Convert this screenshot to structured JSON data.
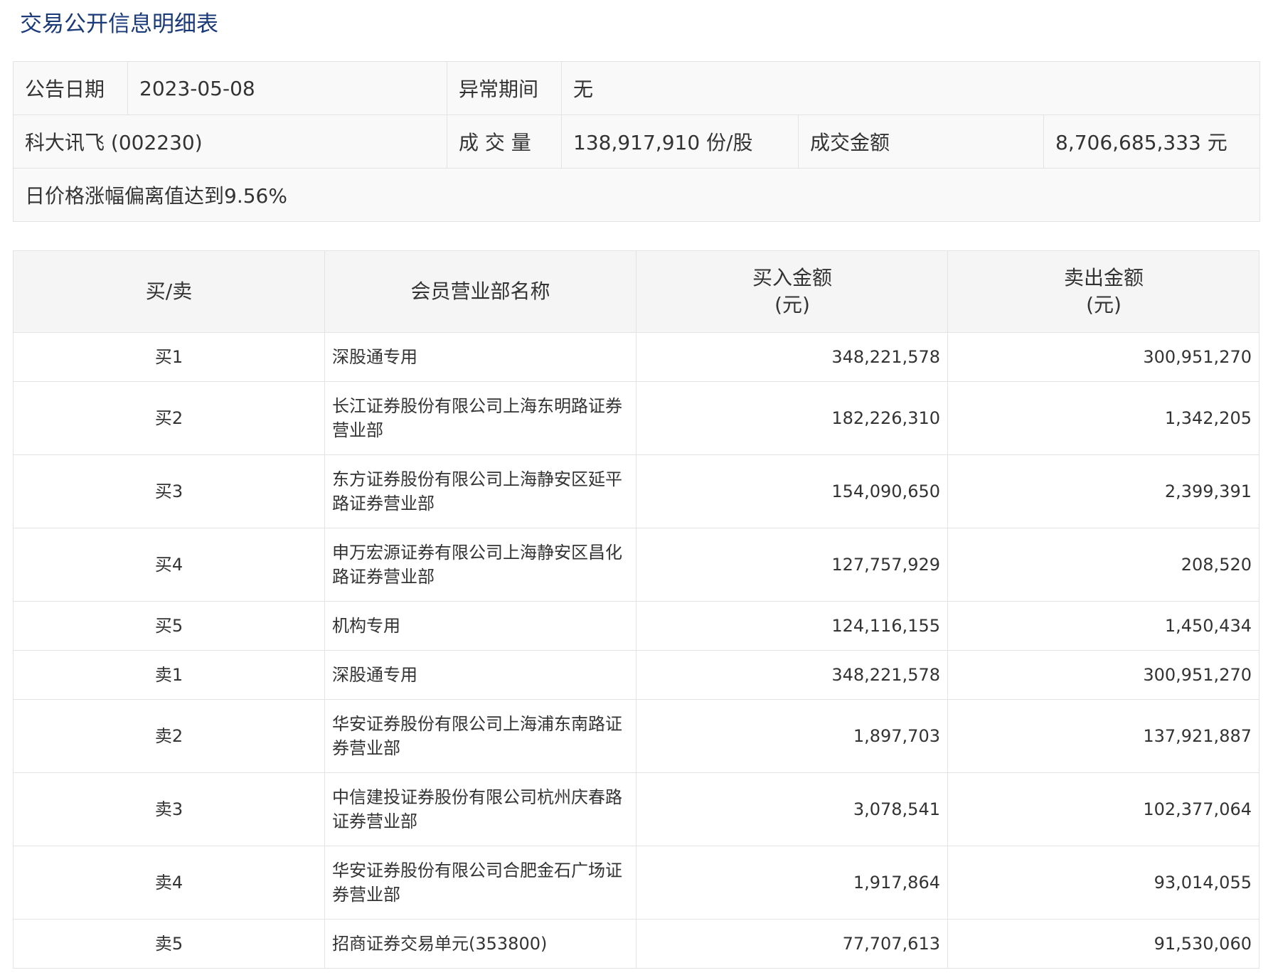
{
  "title": "交易公开信息明细表",
  "summary": {
    "announce_date_label": "公告日期",
    "announce_date": "2023-05-08",
    "abnormal_period_label": "异常期间",
    "abnormal_period": "无",
    "stock": "科大讯飞 (002230)",
    "volume_label": "成 交 量",
    "volume": "138,917,910 份/股",
    "amount_label": "成交金额",
    "amount": "8,706,685,333 元",
    "reason": "日价格涨幅偏离值达到9.56%"
  },
  "table": {
    "headers": {
      "side": "买/卖",
      "name": "会员营业部名称",
      "buy_line1": "买入金额",
      "buy_line2": "(元)",
      "sell_line1": "卖出金额",
      "sell_line2": "(元)"
    },
    "rows": [
      {
        "side": "买1",
        "name": "深股通专用",
        "buy": "348,221,578",
        "sell": "300,951,270"
      },
      {
        "side": "买2",
        "name": "长江证券股份有限公司上海东明路证券营业部",
        "buy": "182,226,310",
        "sell": "1,342,205"
      },
      {
        "side": "买3",
        "name": "东方证券股份有限公司上海静安区延平路证券营业部",
        "buy": "154,090,650",
        "sell": "2,399,391"
      },
      {
        "side": "买4",
        "name": "申万宏源证券有限公司上海静安区昌化路证券营业部",
        "buy": "127,757,929",
        "sell": "208,520"
      },
      {
        "side": "买5",
        "name": "机构专用",
        "buy": "124,116,155",
        "sell": "1,450,434"
      },
      {
        "side": "卖1",
        "name": "深股通专用",
        "buy": "348,221,578",
        "sell": "300,951,270"
      },
      {
        "side": "卖2",
        "name": "华安证券股份有限公司上海浦东南路证券营业部",
        "buy": "1,897,703",
        "sell": "137,921,887"
      },
      {
        "side": "卖3",
        "name": "中信建投证券股份有限公司杭州庆春路证券营业部",
        "buy": "3,078,541",
        "sell": "102,377,064"
      },
      {
        "side": "卖4",
        "name": "华安证券股份有限公司合肥金石广场证券营业部",
        "buy": "1,917,864",
        "sell": "93,014,055"
      },
      {
        "side": "卖5",
        "name": "招商证券交易单元(353800)",
        "buy": "77,707,613",
        "sell": "91,530,060"
      }
    ]
  }
}
